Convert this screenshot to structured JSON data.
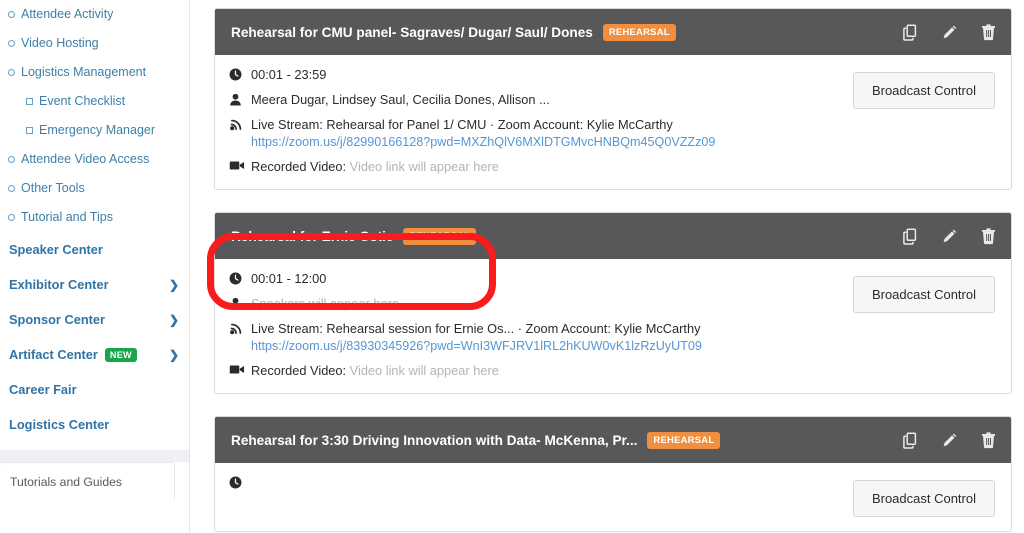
{
  "sidebar": {
    "nav_items": [
      {
        "label": "Attendee Activity",
        "marker": "circle",
        "level": 0
      },
      {
        "label": "Video Hosting",
        "marker": "circle",
        "level": 0
      },
      {
        "label": "Logistics Management",
        "marker": "circle",
        "level": 0
      },
      {
        "label": "Event Checklist",
        "marker": "square",
        "level": 1
      },
      {
        "label": "Emergency Manager",
        "marker": "square",
        "level": 1
      },
      {
        "label": "Attendee Video Access",
        "marker": "circle",
        "level": 0
      },
      {
        "label": "Other Tools",
        "marker": "circle",
        "level": 0
      },
      {
        "label": "Tutorial and Tips",
        "marker": "circle",
        "level": 0
      }
    ],
    "sections": [
      {
        "label": "Speaker Center",
        "chevron": false,
        "badge": ""
      },
      {
        "label": "Exhibitor Center",
        "chevron": true,
        "badge": ""
      },
      {
        "label": "Sponsor Center",
        "chevron": true,
        "badge": ""
      },
      {
        "label": "Artifact Center",
        "chevron": true,
        "badge": "NEW"
      },
      {
        "label": "Career Fair",
        "chevron": false,
        "badge": ""
      },
      {
        "label": "Logistics Center",
        "chevron": false,
        "badge": ""
      }
    ],
    "chevron_glyph": "❯",
    "footer_label": "Tutorials and Guides"
  },
  "colors": {
    "header_bg": "#58585a",
    "badge_orange": "#ef8f3f",
    "badge_green": "#19a54b",
    "link_blue": "#5596d6",
    "annotation_red": "#fa1c1c",
    "sidebar_link": "#2f74a5"
  },
  "common": {
    "broadcast_button": "Broadcast Control",
    "recorded_video_label": "Recorded Video:",
    "recorded_video_placeholder": "Video link will appear here",
    "speakers_placeholder": "Speakers will appear here",
    "zoom_account_prefix": "Zoom Account:",
    "live_stream_prefix": "Live Stream:",
    "badge_rehearsal": "REHEARSAL",
    "icons": {
      "copy": "copy-icon",
      "edit": "pencil-icon",
      "delete": "trash-icon",
      "clock": "clock-icon",
      "person": "person-icon",
      "broadcast": "broadcast-icon",
      "video": "video-camera-icon"
    }
  },
  "cards": [
    {
      "title": "Rehearsal for CMU panel- Sagraves/ Dugar/ Saul/ Dones",
      "badge": "REHEARSAL",
      "time": "00:01 - 23:59",
      "speakers": "Meera Dugar, Lindsey Saul, Cecilia Dones, Allison ...",
      "speakers_muted": false,
      "live_stream": "Live Stream: Rehearsal for Panel 1/ CMU · Zoom Account: Kylie McCarthy",
      "url": "https://zoom.us/j/82990166128?pwd=MXZhQlV6MXlDTGMvcHNBQm45Q0VZZz09",
      "recorded_video_label": "Recorded Video:",
      "recorded_video_value": "Video link will appear here",
      "broadcast_button": "Broadcast Control"
    },
    {
      "title": "Rehearsal for Ernie Ostic",
      "badge": "REHEARSAL",
      "time": "00:01 - 12:00",
      "speakers": "Speakers will appear here",
      "speakers_muted": true,
      "live_stream": "Live Stream: Rehearsal session for Ernie Os... · Zoom Account: Kylie McCarthy",
      "url": "https://zoom.us/j/83930345926?pwd=WnI3WFJRV1lRL2hKUW0vK1lzRzUyUT09",
      "recorded_video_label": "Recorded Video:",
      "recorded_video_value": "Video link will appear here",
      "broadcast_button": "Broadcast Control"
    },
    {
      "title": "Rehearsal for 3:30 Driving Innovation with Data- McKenna, Pr...",
      "badge": "REHEARSAL",
      "time": "",
      "speakers": "",
      "speakers_muted": true,
      "live_stream": "",
      "url": "",
      "recorded_video_label": "",
      "recorded_video_value": "",
      "broadcast_button": "Broadcast Control"
    }
  ],
  "annotation": {
    "shape": "rounded-rectangle",
    "color": "#fa1c1c",
    "target": "Rehearsal for Ernie Ostic card header"
  }
}
